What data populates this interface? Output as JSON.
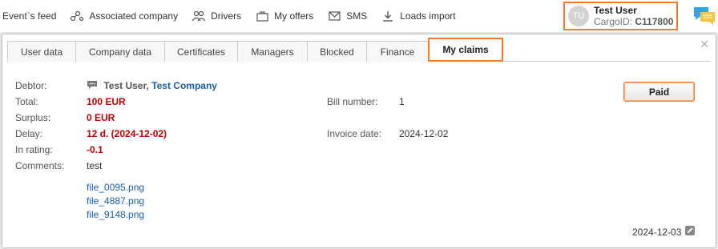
{
  "nav": {
    "items": [
      {
        "label": "Event`s feed",
        "icon": "none"
      },
      {
        "label": "Associated company",
        "icon": "network-icon"
      },
      {
        "label": "Drivers",
        "icon": "drivers-icon"
      },
      {
        "label": "My offers",
        "icon": "briefcase-icon"
      },
      {
        "label": "SMS",
        "icon": "envelope-icon"
      },
      {
        "label": "Loads import",
        "icon": "download-icon"
      }
    ]
  },
  "user": {
    "initials": "TU",
    "name": "Test User",
    "cargo_label": "CargoID:",
    "cargo_id": "C117800"
  },
  "tabs": [
    "User data",
    "Company data",
    "Certificates",
    "Managers",
    "Blocked",
    "Finance",
    "My claims"
  ],
  "active_tab": "My claims",
  "claim": {
    "debtor_label": "Debtor:",
    "debtor_user": "Test User,",
    "debtor_company": "Test Company",
    "total_label": "Total:",
    "total": "100 EUR",
    "surplus_label": "Surplus:",
    "surplus": "0 EUR",
    "delay_label": "Delay:",
    "delay": "12 d. (2024-12-02)",
    "rating_label": "In rating:",
    "rating": "-0.1",
    "comments_label": "Comments:",
    "comments": "test",
    "bill_label": "Bill number:",
    "bill": "1",
    "invoice_label": "Invoice date:",
    "invoice_date": "2024-12-02",
    "files": [
      "file_0095.png",
      "file_4887.png",
      "file_9148.png"
    ],
    "paid_label": "Paid",
    "created_date": "2024-12-03"
  },
  "colors": {
    "accent": "#f07a28",
    "link": "#1a5ea8",
    "alert": "#c00000"
  }
}
